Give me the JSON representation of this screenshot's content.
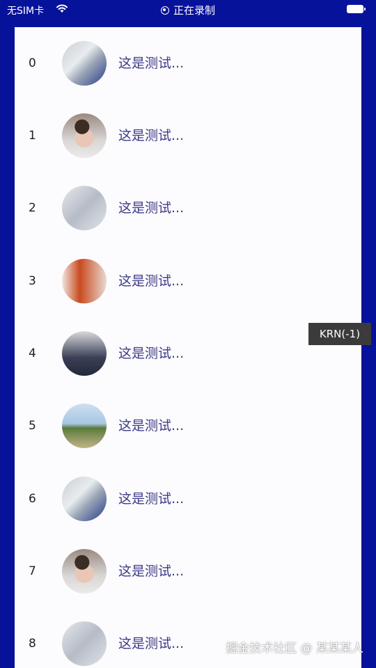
{
  "status_bar": {
    "carrier": "无SIM卡",
    "recording_label": "正在录制"
  },
  "list": {
    "items": [
      {
        "index": "0",
        "title": "这是测试...",
        "avatar": "room-photo"
      },
      {
        "index": "1",
        "title": "这是测试...",
        "avatar": "girl-photo"
      },
      {
        "index": "2",
        "title": "这是测试...",
        "avatar": "sky-photo"
      },
      {
        "index": "3",
        "title": "这是测试...",
        "avatar": "book-photo"
      },
      {
        "index": "4",
        "title": "这是测试...",
        "avatar": "jacket-photo"
      },
      {
        "index": "5",
        "title": "这是测试...",
        "avatar": "mountain-photo"
      },
      {
        "index": "6",
        "title": "这是测试...",
        "avatar": "room-photo"
      },
      {
        "index": "7",
        "title": "这是测试...",
        "avatar": "girl-photo"
      },
      {
        "index": "8",
        "title": "这是测试...",
        "avatar": "sky-photo"
      }
    ]
  },
  "overlay": {
    "debug_badge": "KRN(-1)",
    "watermark": "掘金技术社区 @ 某某某人"
  },
  "colors": {
    "background": "#07129a",
    "list_background": "#fcfbfd",
    "title_text": "#3c3a88"
  }
}
